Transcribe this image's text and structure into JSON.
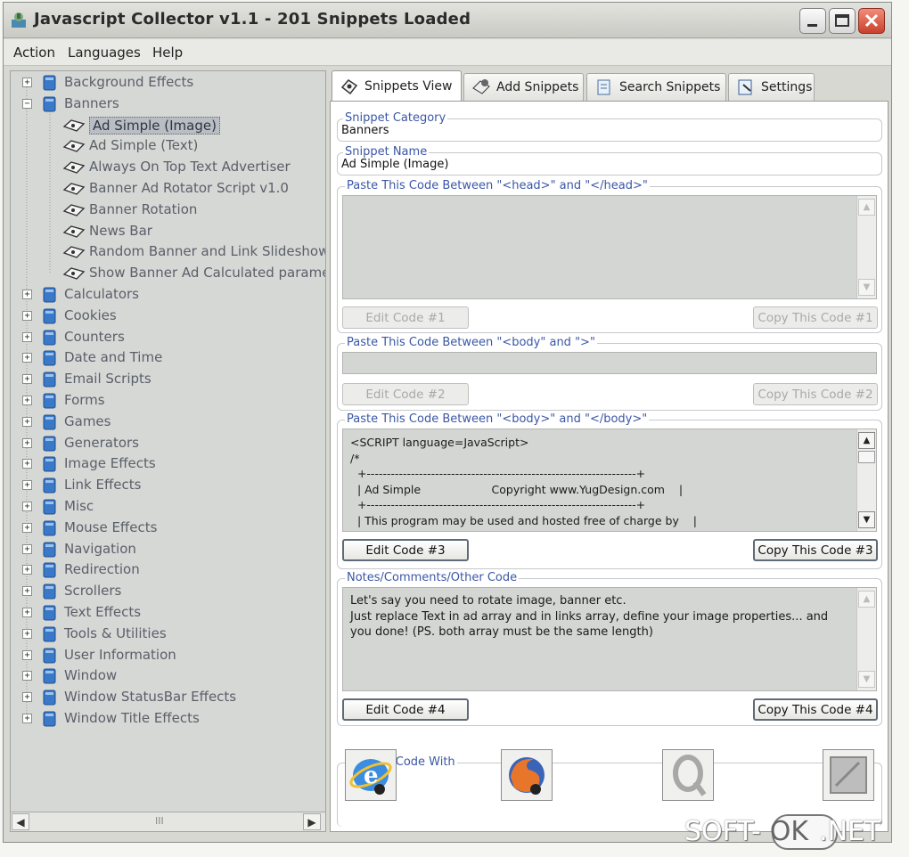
{
  "window": {
    "title": "Javascript Collector v1.1  -  201 Snippets Loaded",
    "controls": [
      "minimize-icon",
      "maximize-icon",
      "close-icon"
    ]
  },
  "menu": [
    "Action",
    "Languages",
    "Help"
  ],
  "tree": {
    "categories_top": [
      "Background Effects",
      "Banners"
    ],
    "banners_children": [
      "Ad Simple (Image)",
      "Ad Simple (Text)",
      "Always On Top Text Advertiser",
      "Banner Ad Rotator Script v1.0",
      "Banner Rotation",
      "News Bar",
      "Random Banner and Link Slideshow",
      "Show Banner Ad Calculated paramete"
    ],
    "selected": "Ad Simple (Image)",
    "categories_rest": [
      "Calculators",
      "Cookies",
      "Counters",
      "Date and Time",
      "Email Scripts",
      "Forms",
      "Games",
      "Generators",
      "Image Effects",
      "Link Effects",
      "Misc",
      "Mouse Effects",
      "Navigation",
      "Redirection",
      "Scrollers",
      "Text Effects",
      "Tools & Utilities",
      "User Information",
      "Window",
      "Window StatusBar Effects",
      "Window Title Effects"
    ],
    "scroll_thumb": "III"
  },
  "tabs": [
    "Snippets View",
    "Add Snippets",
    "Search Snippets",
    "Settings"
  ],
  "active_tab": "Snippets View",
  "snippet": {
    "category_label": "Snippet Category",
    "category_value": "Banners",
    "name_label": "Snippet Name",
    "name_value": "Ad Simple (Image)"
  },
  "code1": {
    "legend": "Paste This Code Between \"<head>\" and \"</head>\"",
    "edit": "Edit Code #1",
    "copy": "Copy This Code #1"
  },
  "code2": {
    "legend": "Paste This Code Between \"<body\" and \">\"",
    "edit": "Edit Code #2",
    "copy": "Copy This Code #2"
  },
  "code3": {
    "legend": "Paste This Code Between \"<body>\" and \"</body>\"",
    "lines": [
      "<SCRIPT language=JavaScript>",
      "/*",
      "  +-------------------------------------------------------------------+",
      "  | Ad Simple                    Copyright www.YugDesign.com    |",
      "  +-------------------------------------------------------------------+",
      "  | This program may be used and hosted free of charge by    |"
    ],
    "edit": "Edit Code #3",
    "copy": "Copy This Code #3"
  },
  "code4": {
    "legend": "Notes/Comments/Other Code",
    "lines": [
      "Let's say you need to rotate image, banner etc.",
      "Just replace Text in ad array and in links array, define your image properties... and",
      "you done! (PS. both array must be the same length)"
    ],
    "edit": "Edit Code #4",
    "copy": "Copy This Code #4"
  },
  "preview": {
    "legend": "Preview Code With",
    "browsers": [
      "internet-explorer-icon",
      "firefox-icon",
      "opera-icon",
      "generic-browser-icon"
    ]
  },
  "watermark": {
    "left": "SOFT-",
    "mid": "OK",
    "right": ".NET"
  },
  "colors": {
    "legend_blue": "#3b57a6",
    "tree_bg": "#d6d8d6",
    "code_bg": "#d4d6d3"
  }
}
